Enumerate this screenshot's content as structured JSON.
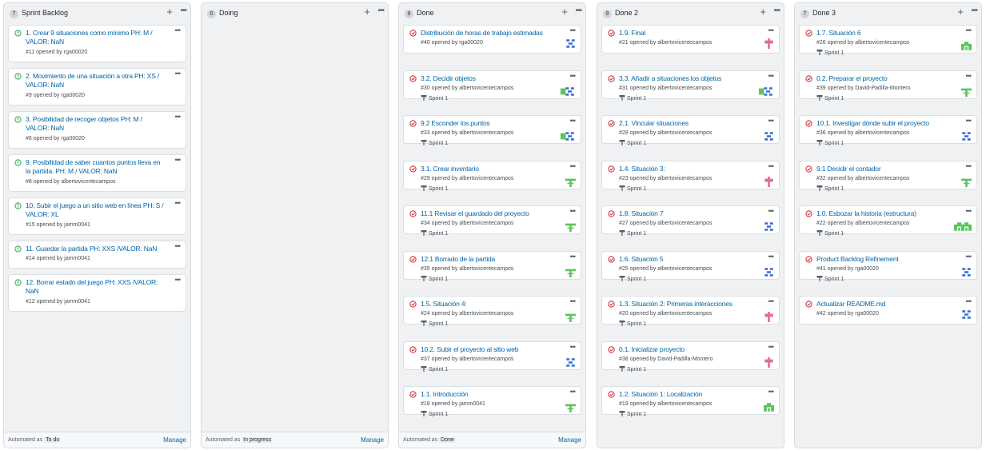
{
  "columns": [
    {
      "count": "7",
      "title": "Sprint Backlog",
      "automated_prefix": "Automated as",
      "automated_value": "To do",
      "manage_label": "Manage",
      "cards": [
        {
          "title": "1. Crear 9 situaciones como mínimo PH: M / VALOR: NaN",
          "meta": "#11 opened by rga00020",
          "icon": "issue-open-icon",
          "lines": 2
        },
        {
          "title": "2. Movimiento de una situación a otra PH: XS / VALOR: NaN",
          "meta": "#9 opened by rga00020",
          "icon": "issue-open-icon",
          "lines": 2
        },
        {
          "title": "3. Posibilidad de recoger objetos PH: M / VALOR: NaN",
          "meta": "#6 opened by rga00020",
          "icon": "issue-open-icon",
          "lines": 2
        },
        {
          "title": "9. Posibilidad de saber cuantos puntos lleva en la partida. PH: M / VALOR: NaN",
          "meta": "#8 opened by albertovicentecampos",
          "icon": "issue-open-icon",
          "lines": 2
        },
        {
          "title": "10. Subir el juego a un sitio web en línea PH: S / VALOR: XL",
          "meta": "#15 opened by jamm0041",
          "icon": "issue-open-icon",
          "lines": 2
        },
        {
          "title": "11. Guardar la partida PH: XXS /VALOR: NaN",
          "meta": "#14 opened by jamm0041",
          "icon": "issue-open-icon",
          "lines": 1
        },
        {
          "title": "12. Borrar estado del juego PH: XXS /VALOR: NaN",
          "meta": "#12 opened by jamm0041",
          "icon": "issue-open-icon",
          "lines": 2
        }
      ]
    },
    {
      "count": "0",
      "title": "Doing",
      "automated_prefix": "Automated as",
      "automated_value": "In progress",
      "manage_label": "Manage",
      "cards": []
    },
    {
      "count": "9",
      "title": "Done",
      "automated_prefix": "Automated as",
      "automated_value": "Done",
      "manage_label": "Manage",
      "cards": [
        {
          "title": "Distribución de horas de trabajo estimadas",
          "meta": "#40 opened by rga00020",
          "icon": "issue-closed-icon",
          "sprint": "",
          "avatar": "blue"
        },
        {
          "title": "3.2. Decidir objetos",
          "meta": "#30 opened by albertovicentecampos",
          "icon": "issue-closed-icon",
          "sprint": "Sprint 1",
          "avatar": "green-blue"
        },
        {
          "title": "9.2 Esconder los puntos",
          "meta": "#33 opened by albertovicentecampos",
          "icon": "issue-closed-icon",
          "sprint": "Sprint 1",
          "avatar": "green-blue"
        },
        {
          "title": "3.1. Crear inventario",
          "meta": "#29 opened by albertovicentecampos",
          "icon": "issue-closed-icon",
          "sprint": "Sprint 1",
          "avatar": "green"
        },
        {
          "title": "11.1 Revisar el guardado del proyecto",
          "meta": "#34 opened by albertovicentecampos",
          "icon": "issue-closed-icon",
          "sprint": "Sprint 1",
          "avatar": "green"
        },
        {
          "title": "12.1 Borrado de la partida",
          "meta": "#35 opened by albertovicentecampos",
          "icon": "issue-closed-icon",
          "sprint": "Sprint 1",
          "avatar": "green"
        },
        {
          "title": "1.5. Situación 4:",
          "meta": "#24 opened by albertovicentecampos",
          "icon": "issue-closed-icon",
          "sprint": "Sprint 1",
          "avatar": "green"
        },
        {
          "title": "10.2. Subir el proyecto al sitio web",
          "meta": "#37 opened by albertovicentecampos",
          "icon": "issue-closed-icon",
          "sprint": "Sprint 1",
          "avatar": "blue"
        },
        {
          "title": "1.1. Introducción",
          "meta": "#18 opened by jamm0041",
          "icon": "issue-closed-icon",
          "sprint": "Sprint 1",
          "avatar": "green"
        }
      ]
    },
    {
      "count": "9",
      "title": "Done 2",
      "cards": [
        {
          "title": "1.9. Final",
          "meta": "#21 opened by albertovicentecampos",
          "icon": "issue-closed-icon",
          "sprint": "",
          "avatar": "pink"
        },
        {
          "title": "3.3. Añadir a situaciones los objetos",
          "meta": "#31 opened by albertovicentecampos",
          "icon": "issue-closed-icon",
          "sprint": "Sprint 1",
          "avatar": "green-blue"
        },
        {
          "title": "2.1. Vincular situaciones",
          "meta": "#28 opened by albertovicentecampos",
          "icon": "issue-closed-icon",
          "sprint": "Sprint 1",
          "avatar": "blue"
        },
        {
          "title": "1.4. Situación 3:",
          "meta": "#23 opened by albertovicentecampos",
          "icon": "issue-closed-icon",
          "sprint": "Sprint 1",
          "avatar": "pink"
        },
        {
          "title": "1.8. Situación 7",
          "meta": "#27 opened by albertovicentecampos",
          "icon": "issue-closed-icon",
          "sprint": "Sprint 1",
          "avatar": "blue"
        },
        {
          "title": "1.6. Situación 5",
          "meta": "#25 opened by albertovicentecampos",
          "icon": "issue-closed-icon",
          "sprint": "Sprint 1",
          "avatar": "blue"
        },
        {
          "title": "1.3. Situación 2: Primeras interacciones",
          "meta": "#20 opened by albertovicentecampos",
          "icon": "issue-closed-icon",
          "sprint": "Sprint 1",
          "avatar": "pink"
        },
        {
          "title": "0.1. Inicializar proyecto",
          "meta": "#38 opened by David-Padilla-Montero",
          "icon": "issue-closed-icon",
          "sprint": "Sprint 1",
          "avatar": "pink"
        },
        {
          "title": "1.2. Situación 1: Localización",
          "meta": "#19 opened by albertovicentecampos",
          "icon": "issue-closed-icon",
          "sprint": "Sprint 1",
          "avatar": "green2"
        }
      ]
    },
    {
      "count": "7",
      "title": "Done 3",
      "cards": [
        {
          "title": "1.7. Situación 6",
          "meta": "#26 opened by albertovicentecampos",
          "icon": "issue-closed-icon",
          "sprint": "Sprint 1",
          "avatar": "green2"
        },
        {
          "title": "0.2. Preparar el proyecto",
          "meta": "#39 opened by David-Padilla-Montero",
          "icon": "issue-closed-icon",
          "sprint": "Sprint 1",
          "avatar": "green"
        },
        {
          "title": "10.1. Investigar dónde subir el proyecto",
          "meta": "#36 opened by albertovicentecampos",
          "icon": "issue-closed-icon",
          "sprint": "Sprint 1",
          "avatar": "blue"
        },
        {
          "title": "9.1 Decidir el contador",
          "meta": "#32 opened by albertovicentecampos",
          "icon": "issue-closed-icon",
          "sprint": "Sprint 1",
          "avatar": "green"
        },
        {
          "title": "1.0. Esbozar la historia (estructura)",
          "meta": "#22 opened by albertovicentecampos",
          "icon": "issue-closed-icon",
          "sprint": "Sprint 1",
          "avatar": "green2-double"
        },
        {
          "title": "Product Backlog Refinement",
          "meta": "#41 opened by rga00020",
          "icon": "issue-closed-icon",
          "sprint": "Sprint 1",
          "avatar": "blue"
        },
        {
          "title": "Actualizar README.md",
          "meta": "#42 opened by rga00020",
          "icon": "issue-closed-icon",
          "sprint": "",
          "avatar": "blue"
        }
      ]
    }
  ],
  "colors": {
    "open": "#28a745",
    "closed": "#cb2431",
    "link": "#0366a6",
    "avatar_blue": "#3b6fd0",
    "avatar_green": "#5cc45c",
    "avatar_pink": "#e06d8e"
  }
}
